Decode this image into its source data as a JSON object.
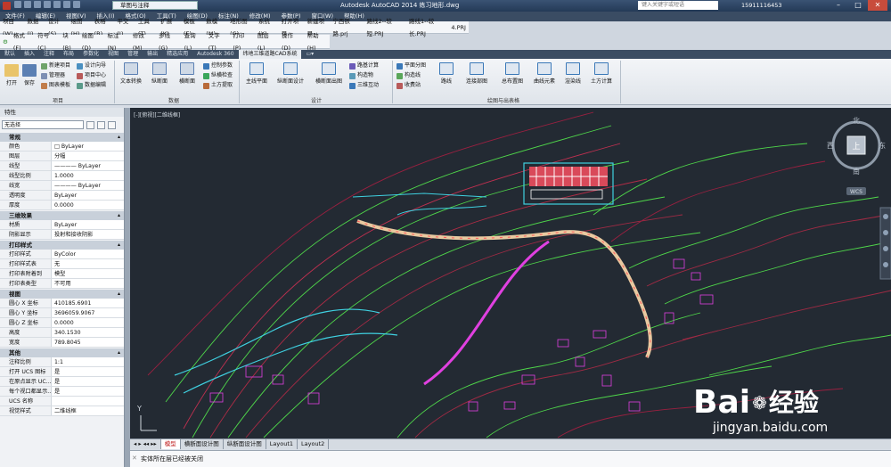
{
  "titlebar": {
    "workspace": "草图与注释",
    "title": "Autodesk AutoCAD 2014    练习地形.dwg",
    "search_placeholder": "键入关键字或短语",
    "user": "15911116453"
  },
  "menubar": [
    "文件(F)",
    "编辑(E)",
    "视图(V)",
    "插入(I)",
    "格式(O)",
    "工具(T)",
    "绘图(D)",
    "标注(N)",
    "修改(M)",
    "参数(P)",
    "窗口(W)",
    "帮助(H)"
  ],
  "custbar1": [
    "项目(W)",
    "数据(J)",
    "设计(S)",
    "绘图(H)",
    "表格(B)",
    "平交(I)",
    "工具(T)",
    "扩展(K)",
    "模板(E)",
    "数模(M)",
    "地形图(G)",
    "系统(X)",
    "打开项目",
    "新建项目",
    "宁西铁路.prj",
    "路线2--较短.PRJ",
    "路线1--较长.PRJ",
    "4.PRJ"
  ],
  "custbar2": [
    "格式(F)",
    "符号(C)",
    "块(B)",
    "绘图(D)",
    "标注(N)",
    "修改(M)",
    "多线(G)",
    "查询(L)",
    "文字(T)",
    "打印(P)",
    "图层(L)",
    "操作(D)",
    "帮助(H)"
  ],
  "ribbontabs": [
    "默认",
    "插入",
    "注释",
    "布局",
    "参数化",
    "视图",
    "管理",
    "输出",
    "精选应用",
    "Autodesk 360",
    "纬地三维道路CAD系统"
  ],
  "ribbon": {
    "big": [
      "打开",
      "保存",
      "文本转换",
      "纵断面",
      "横断面",
      "主线平面",
      "纵断面设计",
      "横断面出图",
      "路线",
      "连接部图",
      "总布置图",
      "曲线元素",
      "渲染线",
      "土方计算"
    ],
    "small": [
      "新建项目",
      "管理器",
      "图表模板",
      "设计向导",
      "项目中心",
      "数据编辑",
      "控制参数",
      "纵横检查",
      "土方提取",
      "路基计算",
      "构造物",
      "三维互动",
      "平面分图",
      "构造线",
      "收费站"
    ],
    "groups": [
      "项目",
      "数据",
      "设计",
      "绘图与出表格"
    ]
  },
  "props": {
    "header": "特性",
    "selection": "无选择",
    "sections": [
      {
        "title": "常规",
        "rows": [
          [
            "颜色",
            "□ ByLayer"
          ],
          [
            "图层",
            "分幅"
          ],
          [
            "线型",
            "———— ByLayer"
          ],
          [
            "线型比例",
            "1.0000"
          ],
          [
            "线宽",
            "———— ByLayer"
          ],
          [
            "透明度",
            "ByLayer"
          ],
          [
            "厚度",
            "0.0000"
          ]
        ]
      },
      {
        "title": "三维效果",
        "rows": [
          [
            "材质",
            "ByLayer"
          ],
          [
            "阴影显示",
            "投射和接收阴影"
          ]
        ]
      },
      {
        "title": "打印样式",
        "rows": [
          [
            "打印样式",
            "ByColor"
          ],
          [
            "打印样式表",
            "无"
          ],
          [
            "打印表附着到",
            "模型"
          ],
          [
            "打印表类型",
            "不可用"
          ]
        ]
      },
      {
        "title": "视图",
        "rows": [
          [
            "圆心 X 坐标",
            "410185.6901"
          ],
          [
            "圆心 Y 坐标",
            "3696059.9067"
          ],
          [
            "圆心 Z 坐标",
            "0.0000"
          ],
          [
            "高度",
            "340.1530"
          ],
          [
            "宽度",
            "789.8045"
          ]
        ]
      },
      {
        "title": "其他",
        "rows": [
          [
            "注释比例",
            "1:1"
          ],
          [
            "打开 UCS 图标",
            "是"
          ],
          [
            "在原点显示 UC...",
            "是"
          ],
          [
            "每个视口都显示...",
            "是"
          ],
          [
            "UCS 名称",
            ""
          ],
          [
            "视觉样式",
            "二维线框"
          ]
        ]
      }
    ]
  },
  "canvas": {
    "view_label": "[-][俯视][二维线框]",
    "ucs_y": "Y",
    "viewcube": {
      "north": "北",
      "south": "南",
      "east": "东",
      "west": "西",
      "top": "上",
      "wcs": "WCS"
    }
  },
  "layouttabs": [
    "模型",
    "横断面设计图",
    "纵断面设计图",
    "Layout1",
    "Layout2"
  ],
  "cmdline": {
    "text": "实体所在层已经被关闭"
  },
  "watermark": {
    "brand": "Bai",
    "brand_cn": "经验",
    "url": "jingyan.baidu.com"
  }
}
